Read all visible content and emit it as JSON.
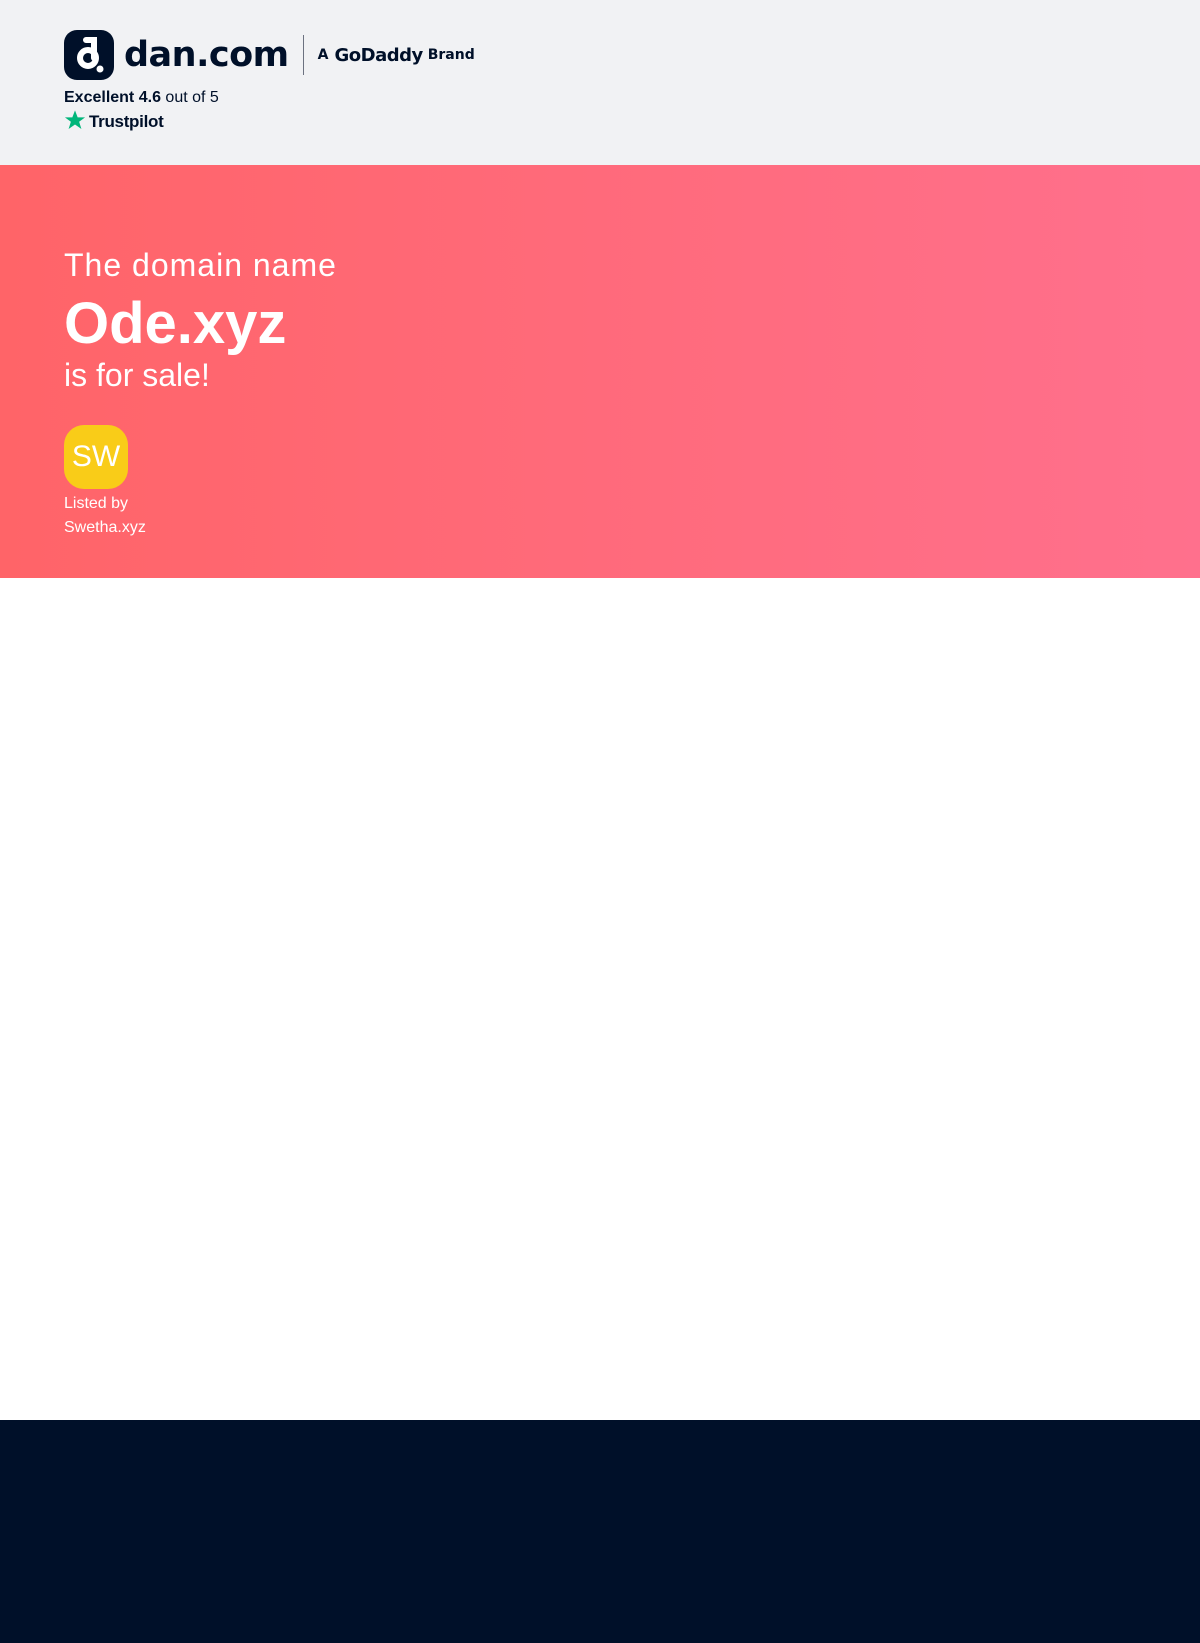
{
  "header": {
    "logo": {
      "icon": "dan-logo-icon",
      "wordmark": "dan.com",
      "brand_prefix": "A",
      "brand_name": "GoDaddy",
      "brand_suffix": "Brand"
    },
    "rating": {
      "label": "Excellent",
      "score": "4.6",
      "out_of": "out of 5",
      "provider": "Trustpilot",
      "provider_icon": "trustpilot-star-icon",
      "star_color": "#00b67a"
    }
  },
  "hero": {
    "line1": "The domain name",
    "domain": "Ode.xyz",
    "line3": "is for sale!",
    "seller": {
      "initials": "SW",
      "listed_by_label": "Listed by",
      "name": "Swetha.xyz",
      "avatar_color": "#f9cc18"
    },
    "gradient_start": "#ff6468",
    "gradient_end": "#ff708d"
  },
  "colors": {
    "header_bg": "#f1f2f4",
    "navy": "#001029",
    "footer_bg": "#001029"
  }
}
